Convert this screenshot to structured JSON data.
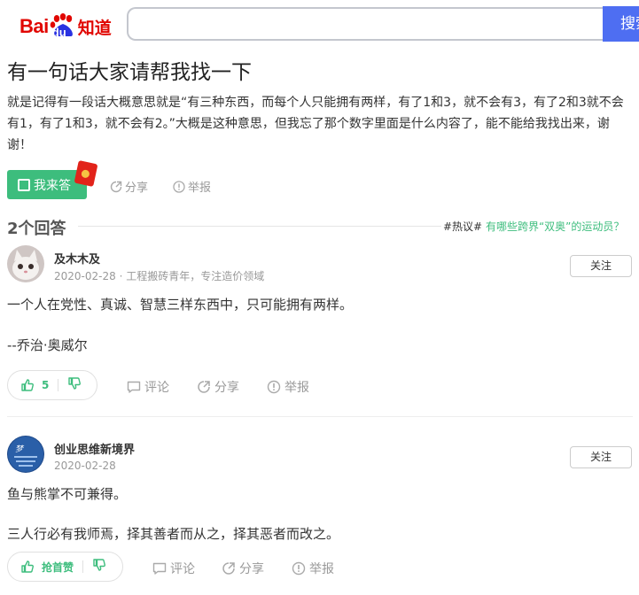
{
  "header": {
    "logo_bai": "Bai",
    "logo_du": "du",
    "logo_zhidao": "知道",
    "search_value": "",
    "search_button": "搜索"
  },
  "question": {
    "title": "有一句话大家请帮我找一下",
    "body": "就是记得有一段话大概意思就是“有三种东西，而每个人只能拥有两样，有了1和3，就不会有3，有了2和3就不会有1，有了1和3，就不会有2。”大概是这种意思，但我忘了那个数字里面是什么内容了，能不能给我找出来，谢谢！",
    "answer_button": "我来答",
    "share": "分享",
    "report": "举报"
  },
  "answers_header": {
    "count": "2个回答",
    "hot_tag": "#热议#",
    "hot_link": "有哪些跨界“双奥”的运动员？"
  },
  "answers": [
    {
      "author": "及木木及",
      "date": "2020-02-28",
      "meta": "· 工程搬砖青年，专注造价领域",
      "follow": "关注",
      "lines": [
        "一个人在党性、真诚、智慧三样东西中，只可能拥有两样。",
        "--乔治·奥威尔"
      ],
      "votes": "5",
      "comment": "评论",
      "share": "分享",
      "report": "举报"
    },
    {
      "author": "创业思维新境界",
      "date": "2020-02-28",
      "meta": "",
      "follow": "关注",
      "lines": [
        "鱼与熊掌不可兼得。",
        "三人行必有我师焉，择其善者而从之，择其恶者而改之。"
      ],
      "votes": "抢首赞",
      "comment": "评论",
      "share": "分享",
      "report": "举报"
    }
  ],
  "colors": {
    "brand_red": "#e10601",
    "brand_blue": "#2932e1",
    "search_blue": "#4e6ef2",
    "accent_green": "#3dbd7d"
  }
}
